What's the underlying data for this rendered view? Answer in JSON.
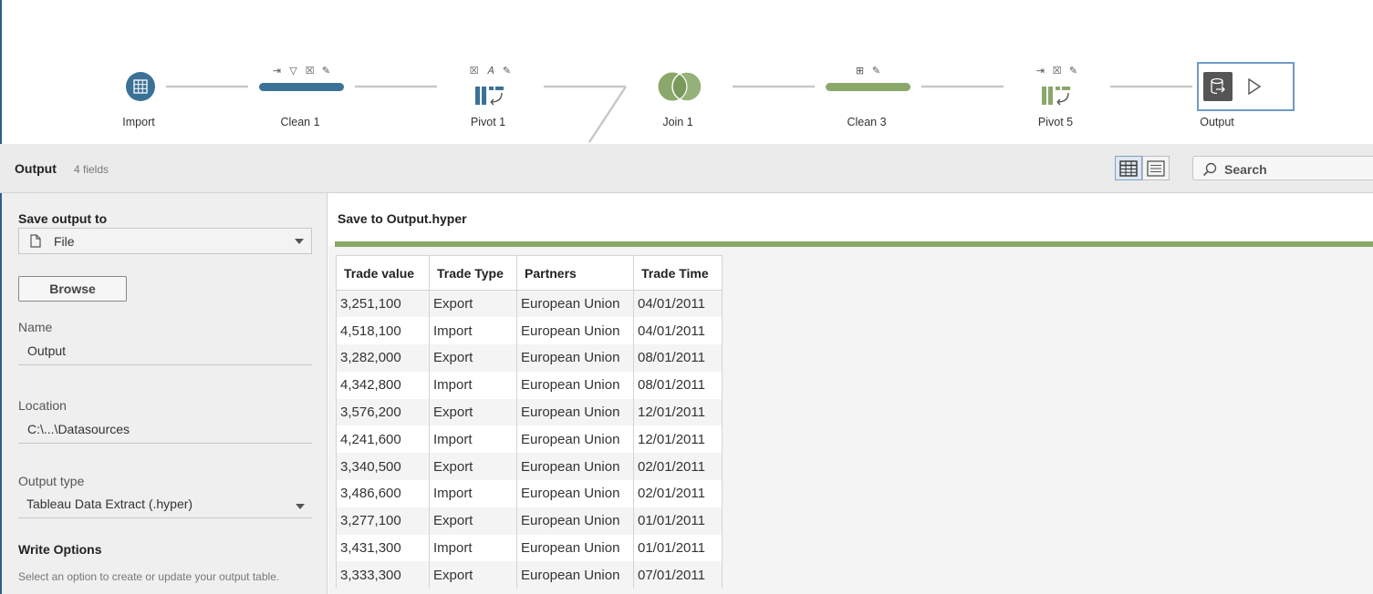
{
  "flow": {
    "steps": [
      {
        "id": "import",
        "label": "Import",
        "icon": "table-icon"
      },
      {
        "id": "clean1",
        "label": "Clean 1",
        "icon": "clean-step-icon"
      },
      {
        "id": "pivot1",
        "label": "Pivot 1",
        "icon": "pivot-icon"
      },
      {
        "id": "join1",
        "label": "Join 1",
        "icon": "join-icon"
      },
      {
        "id": "clean3",
        "label": "Clean 3",
        "icon": "clean-step-icon"
      },
      {
        "id": "pivot5",
        "label": "Pivot 5",
        "icon": "pivot-icon"
      },
      {
        "id": "output",
        "label": "Output",
        "icon": "output-icon"
      }
    ],
    "colors": {
      "blue": "#3b7197",
      "green": "#8aa86a",
      "line": "#c8c8c8"
    }
  },
  "header": {
    "title": "Output",
    "field_count": "4 fields",
    "search_placeholder": "Search"
  },
  "left_panel": {
    "save_output_to_label": "Save output to",
    "save_output_to_value": "File",
    "browse_label": "Browse",
    "name_label": "Name",
    "name_value": "Output",
    "location_label": "Location",
    "location_value": "C:\\...\\Datasources",
    "output_type_label": "Output type",
    "output_type_value": "Tableau Data Extract (.hyper)",
    "write_options_label": "Write Options",
    "write_options_hint": "Select an option to create or update your output table."
  },
  "right_panel": {
    "save_title": "Save to Output.hyper",
    "progress": 1.0,
    "columns": [
      "Trade value",
      "Trade Type",
      "Partners",
      "Trade Time"
    ],
    "rows": [
      [
        "3,251,100",
        "Export",
        "European Union",
        "04/01/2011"
      ],
      [
        "4,518,100",
        "Import",
        "European Union",
        "04/01/2011"
      ],
      [
        "3,282,000",
        "Export",
        "European Union",
        "08/01/2011"
      ],
      [
        "4,342,800",
        "Import",
        "European Union",
        "08/01/2011"
      ],
      [
        "3,576,200",
        "Export",
        "European Union",
        "12/01/2011"
      ],
      [
        "4,241,600",
        "Import",
        "European Union",
        "12/01/2011"
      ],
      [
        "3,340,500",
        "Export",
        "European Union",
        "02/01/2011"
      ],
      [
        "3,486,600",
        "Import",
        "European Union",
        "02/01/2011"
      ],
      [
        "3,277,100",
        "Export",
        "European Union",
        "01/01/2011"
      ],
      [
        "3,431,300",
        "Import",
        "European Union",
        "01/01/2011"
      ],
      [
        "3,333,300",
        "Export",
        "European Union",
        "07/01/2011"
      ]
    ]
  }
}
